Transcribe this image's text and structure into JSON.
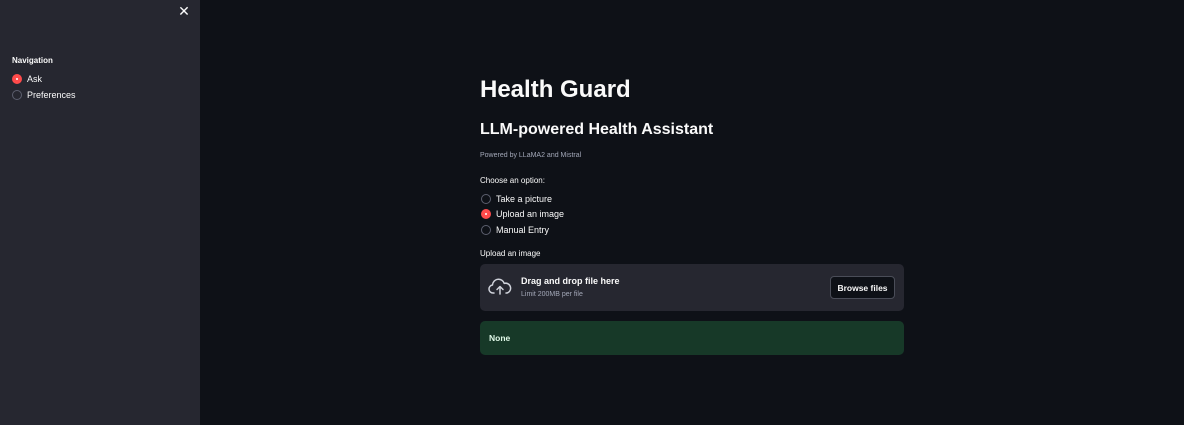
{
  "sidebar": {
    "close_symbol": "✕",
    "nav_title": "Navigation",
    "items": [
      {
        "label": "Ask",
        "selected": true
      },
      {
        "label": "Preferences",
        "selected": false
      }
    ]
  },
  "main": {
    "title": "Health Guard",
    "subtitle": "LLM-powered Health Assistant",
    "caption": "Powered by LLaMA2 and Mistral",
    "choose_label": "Choose an option:",
    "options": [
      {
        "label": "Take a picture",
        "selected": false
      },
      {
        "label": "Upload an image",
        "selected": true
      },
      {
        "label": "Manual Entry",
        "selected": false
      }
    ],
    "uploader": {
      "label": "Upload an image",
      "drop_text": "Drag and drop file here",
      "limit_text": "Limit 200MB per file",
      "browse_label": "Browse files",
      "icon": "cloud-upload-icon"
    },
    "result_text": "None"
  },
  "colors": {
    "background": "#0e1117",
    "sidebar": "#262730",
    "accent": "#ff4b4b",
    "success_bg": "#173928"
  }
}
